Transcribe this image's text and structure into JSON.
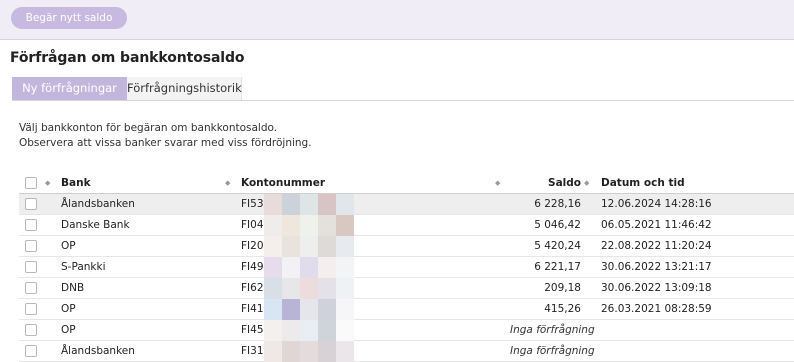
{
  "toolbar": {
    "new_request_label": "Begär nytt saldo"
  },
  "page": {
    "title": "Förfrågan om bankkontosaldo"
  },
  "tabs": [
    {
      "label": "Ny förfrågningar"
    },
    {
      "label": "Förfrågningshistorik"
    }
  ],
  "info": {
    "line1": "Välj bankkonton för begäran om bankkontosaldo.",
    "line2": "Observera att vissa banker svarar med viss fördröjning."
  },
  "table": {
    "columns": {
      "bank": "Bank",
      "account": "Kontonummer",
      "balance": "Saldo",
      "datetime": "Datum och tid"
    },
    "rows": [
      {
        "bank": "Ålandsbanken",
        "account": "FI53",
        "balance": "6 228,16",
        "datetime": "12.06.2024 14:28:16",
        "status": ""
      },
      {
        "bank": "Danske Bank",
        "account": "FI04",
        "balance": "5 046,42",
        "datetime": "06.05.2021 11:46:42",
        "status": ""
      },
      {
        "bank": "OP",
        "account": "FI20",
        "balance": "5 420,24",
        "datetime": "22.08.2022 11:20:24",
        "status": ""
      },
      {
        "bank": "S-Pankki",
        "account": "FI49",
        "balance": "6 221,17",
        "datetime": "30.06.2022 13:21:17",
        "status": ""
      },
      {
        "bank": "DNB",
        "account": "FI62",
        "balance": "209,18",
        "datetime": "30.06.2022 13:09:18",
        "status": ""
      },
      {
        "bank": "OP",
        "account": "FI41 5",
        "balance": "415,26",
        "datetime": "26.03.2021 08:28:59",
        "status": ""
      },
      {
        "bank": "OP",
        "account": "FI45",
        "balance": "",
        "datetime": "",
        "status": "Inga förfrågningar"
      },
      {
        "bank": "Ålandsbanken",
        "account": "FI31 (",
        "balance": "",
        "datetime": "",
        "status": "Inga förfrågningar"
      }
    ]
  },
  "colors": {
    "accent": "#c3b6dc",
    "button": "#c7b9e0",
    "topbar": "#f1edf7"
  }
}
